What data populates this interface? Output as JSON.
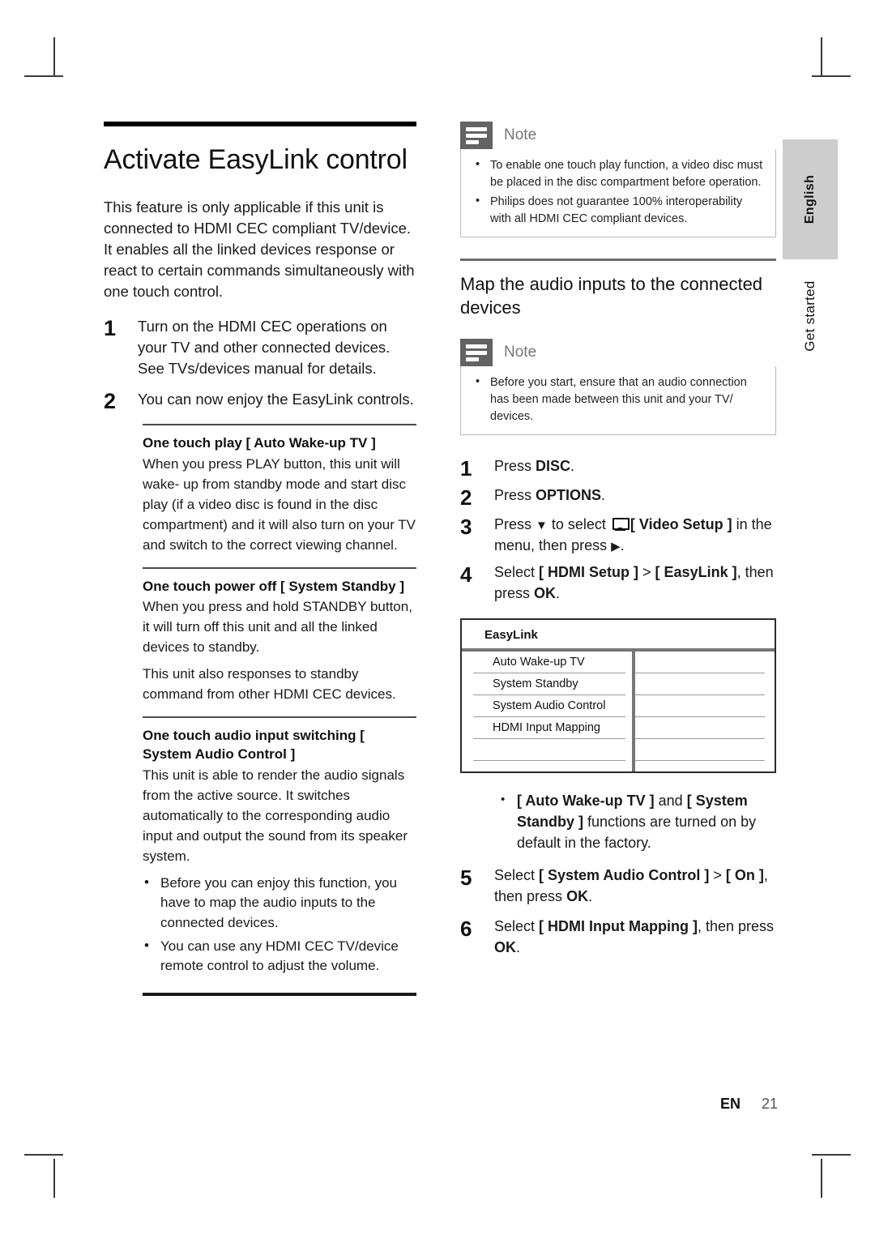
{
  "side_tabs": {
    "language": "English",
    "section": "Get started"
  },
  "left_column": {
    "title": "Activate EasyLink control",
    "intro": "This feature is only applicable if this unit is connected to HDMI CEC compliant TV/device. It enables all the linked devices response or react to certain commands simultaneously with one touch control.",
    "steps": [
      {
        "num": "1",
        "text": "Turn on the HDMI CEC operations on your TV and other connected devices. See TVs/devices manual for details."
      },
      {
        "num": "2",
        "text": "You can now enjoy the EasyLink controls."
      }
    ],
    "subsections": [
      {
        "heading": "One touch play [ Auto Wake-up TV ]",
        "body": "When you press PLAY button, this unit will wake- up from standby mode and start disc play (if a video disc is found in the disc compartment) and it will also turn on your TV and switch to the correct viewing channel."
      },
      {
        "heading": "One touch power off [ System Standby ]",
        "body": "When you press and hold STANDBY button, it will turn off this unit and all the linked devices to standby.",
        "body2": "This unit also responses to standby command from other HDMI CEC devices."
      },
      {
        "heading": "One touch audio input switching [ System Audio Control ]",
        "body": "This unit is able to render the audio signals from the active source.  It switches automatically to the corresponding audio input and output the sound from its speaker system.",
        "bullets": [
          "Before you can enjoy this function, you have to map the audio inputs to the connected devices.",
          "You can use any HDMI CEC TV/device remote control to adjust the volume."
        ]
      }
    ]
  },
  "right_column": {
    "note_top": {
      "title": "Note",
      "icon": "note-lines-icon",
      "bullets": [
        "To enable one touch play function, a video disc must be placed in the disc compartment before operation.",
        "Philips does not guarantee 100% interoperability with all HDMI CEC compliant devices."
      ]
    },
    "section_title": "Map the audio inputs to the connected devices",
    "note_mid": {
      "title": "Note",
      "icon": "note-lines-icon",
      "bullets": [
        "Before you start, ensure that an audio connection has been made between this unit and your TV/ devices."
      ]
    },
    "steps": [
      {
        "num": "1",
        "pre": "Press ",
        "bold": "DISC",
        "post": "."
      },
      {
        "num": "2",
        "pre": "Press ",
        "bold": "OPTIONS",
        "post": "."
      },
      {
        "num": "3",
        "pre": "Press ",
        "arrow_down": "▼",
        "mid": " to select ",
        "icon": "monitor-icon",
        "bold": "[ Video Setup ]",
        "post": " in the menu, then press ",
        "arrow_right": "▶",
        "end": "."
      },
      {
        "num": "4",
        "pre": "Select ",
        "bold": "[ HDMI Setup ]",
        "mid": " > ",
        "bold2": "[ EasyLink ]",
        "post": ", then press ",
        "bold3": "OK",
        "end": "."
      }
    ],
    "osd": {
      "header": "EasyLink",
      "rows": [
        "Auto Wake-up TV",
        "System Standby",
        "System Audio Control",
        "HDMI Input Mapping"
      ],
      "empty_rows": 2
    },
    "osd_note_bullet_pre": "[ Auto Wake-up TV ]",
    "osd_note_bullet_mid": " and ",
    "osd_note_bullet_bold2": "[ System Standby ]",
    "osd_note_bullet_post": " functions are turned on by default in the factory.",
    "steps_after": [
      {
        "num": "5",
        "pre": "Select ",
        "bold": "[ System Audio Control ]",
        "mid": " > ",
        "bold2": "[ On ]",
        "post": ", then press ",
        "bold3": "OK",
        "end": "."
      },
      {
        "num": "6",
        "pre": "Select ",
        "bold": "[ HDMI Input Mapping ]",
        "post": ", then press ",
        "bold3": "OK",
        "end": "."
      }
    ]
  },
  "footer": {
    "lang_code": "EN",
    "page_number": "21"
  }
}
